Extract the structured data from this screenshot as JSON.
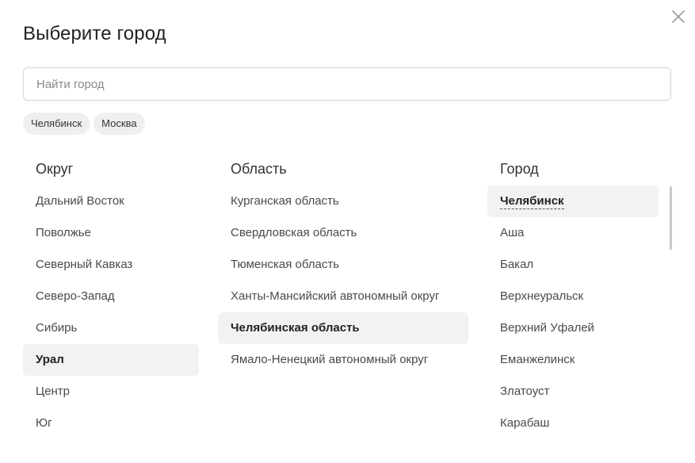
{
  "modal": {
    "title": "Выберите город",
    "close_icon": "close-icon",
    "search": {
      "placeholder": "Найти город",
      "value": ""
    },
    "chips": [
      "Челябинск",
      "Москва"
    ]
  },
  "columns": {
    "okrug": {
      "header": "Округ",
      "items": [
        "Дальний Восток",
        "Поволжье",
        "Северный Кавказ",
        "Северо-Запад",
        "Сибирь",
        "Урал",
        "Центр",
        "Юг"
      ],
      "selected": "Урал"
    },
    "oblast": {
      "header": "Область",
      "items": [
        "Курганская область",
        "Свердловская область",
        "Тюменская область",
        "Ханты-Мансийский автономный округ",
        "Челябинская область",
        "Ямало-Ненецкий автономный округ"
      ],
      "selected": "Челябинская область"
    },
    "gorod": {
      "header": "Город",
      "items": [
        "Челябинск",
        "Аша",
        "Бакал",
        "Верхнеуральск",
        "Верхний Уфалей",
        "Еманжелинск",
        "Златоуст",
        "Карабаш"
      ],
      "selected": "Челябинск"
    }
  },
  "colors": {
    "selected_bg": "#f2f2f2",
    "chip_bg": "#efefef",
    "border": "#d4d4d4",
    "text": "#2b2b2b"
  }
}
